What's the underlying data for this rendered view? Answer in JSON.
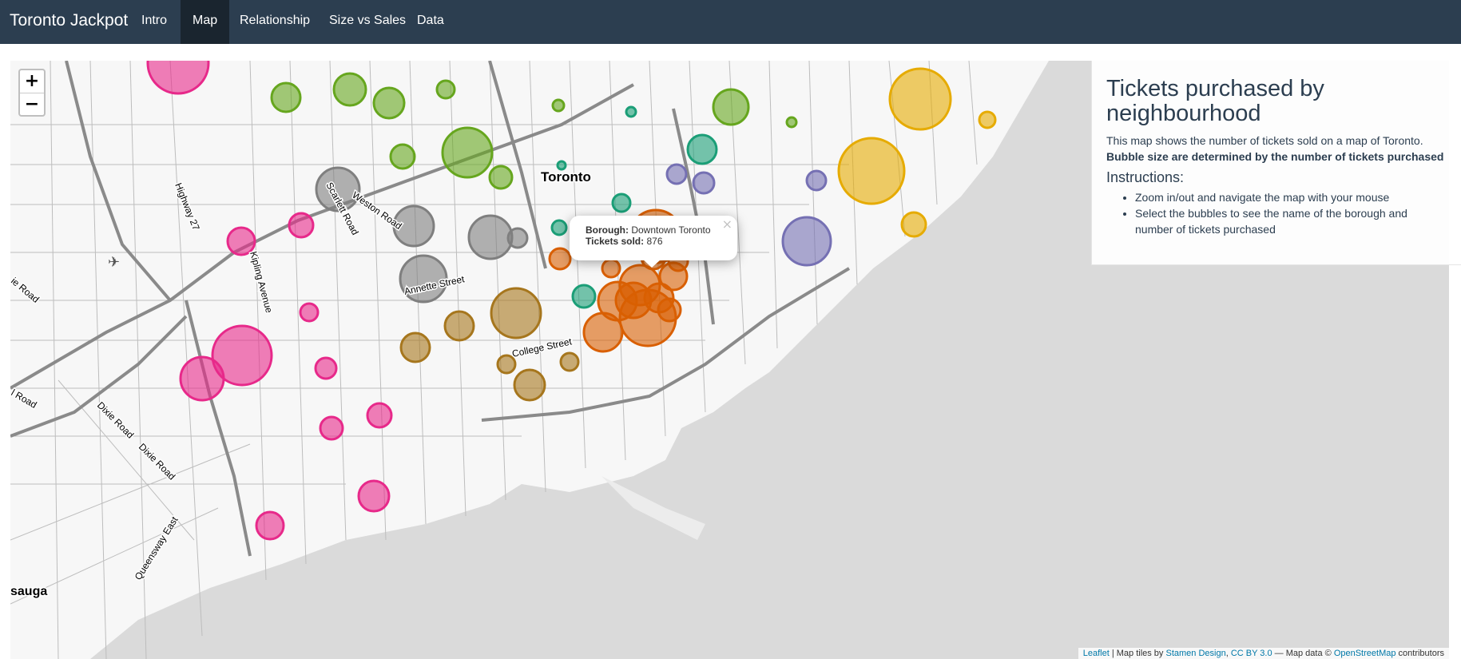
{
  "navbar": {
    "brand": "Toronto Jackpot",
    "tabs": [
      {
        "label": "Intro",
        "active": false
      },
      {
        "label": "Map",
        "active": true
      },
      {
        "label": "Relationship",
        "active": false
      },
      {
        "label": "Size vs Sales",
        "active": false
      },
      {
        "label": "Data",
        "active": false
      }
    ]
  },
  "map": {
    "zoom_in": "+",
    "zoom_out": "−",
    "city_label": "Toronto",
    "corner_label": "sauga",
    "street_labels": [
      "Highway 27",
      "Scarlett Road",
      "Weston Road",
      "Kipling Avenue",
      "Annette Street",
      "College Street",
      "Dixie Road",
      "Dixie Road",
      "Queensway East",
      "ie Road",
      "l Road"
    ],
    "popup": {
      "borough_label": "Borough:",
      "borough_value": "Downtown Toronto",
      "tickets_label": "Tickets sold:",
      "tickets_value": "876",
      "close": "×"
    },
    "colors": {
      "etobicoke": "#e7298a",
      "york": "#7f7f7f",
      "north_york": "#66a61e",
      "east_york": "#1b9e77",
      "west_toronto": "#a6761d",
      "downtown": "#d95f02",
      "east_toronto": "#7570b3",
      "scarborough": "#e6ab02",
      "water": "#dadada",
      "land": "#f7f7f7"
    },
    "attribution": {
      "leaflet": "Leaflet",
      "sep1": " | Map tiles by ",
      "stamen": "Stamen Design",
      "sep2": ", ",
      "license": "CC BY 3.0",
      "sep3": " — Map data © ",
      "osm": "OpenStreetMap",
      "sep4": " contributors"
    }
  },
  "panel": {
    "title": "Tickets purchased by neighbourhood",
    "description": "This map shows the number of tickets sold on a map of Toronto.",
    "bold_note": "Bubble size are determined by the number of tickets purchased",
    "instructions_heading": "Instructions:",
    "instructions": [
      "Zoom in/out and navigate the map with your mouse",
      "Select the bubbles to see the name of the borough and number of tickets purchased"
    ]
  }
}
